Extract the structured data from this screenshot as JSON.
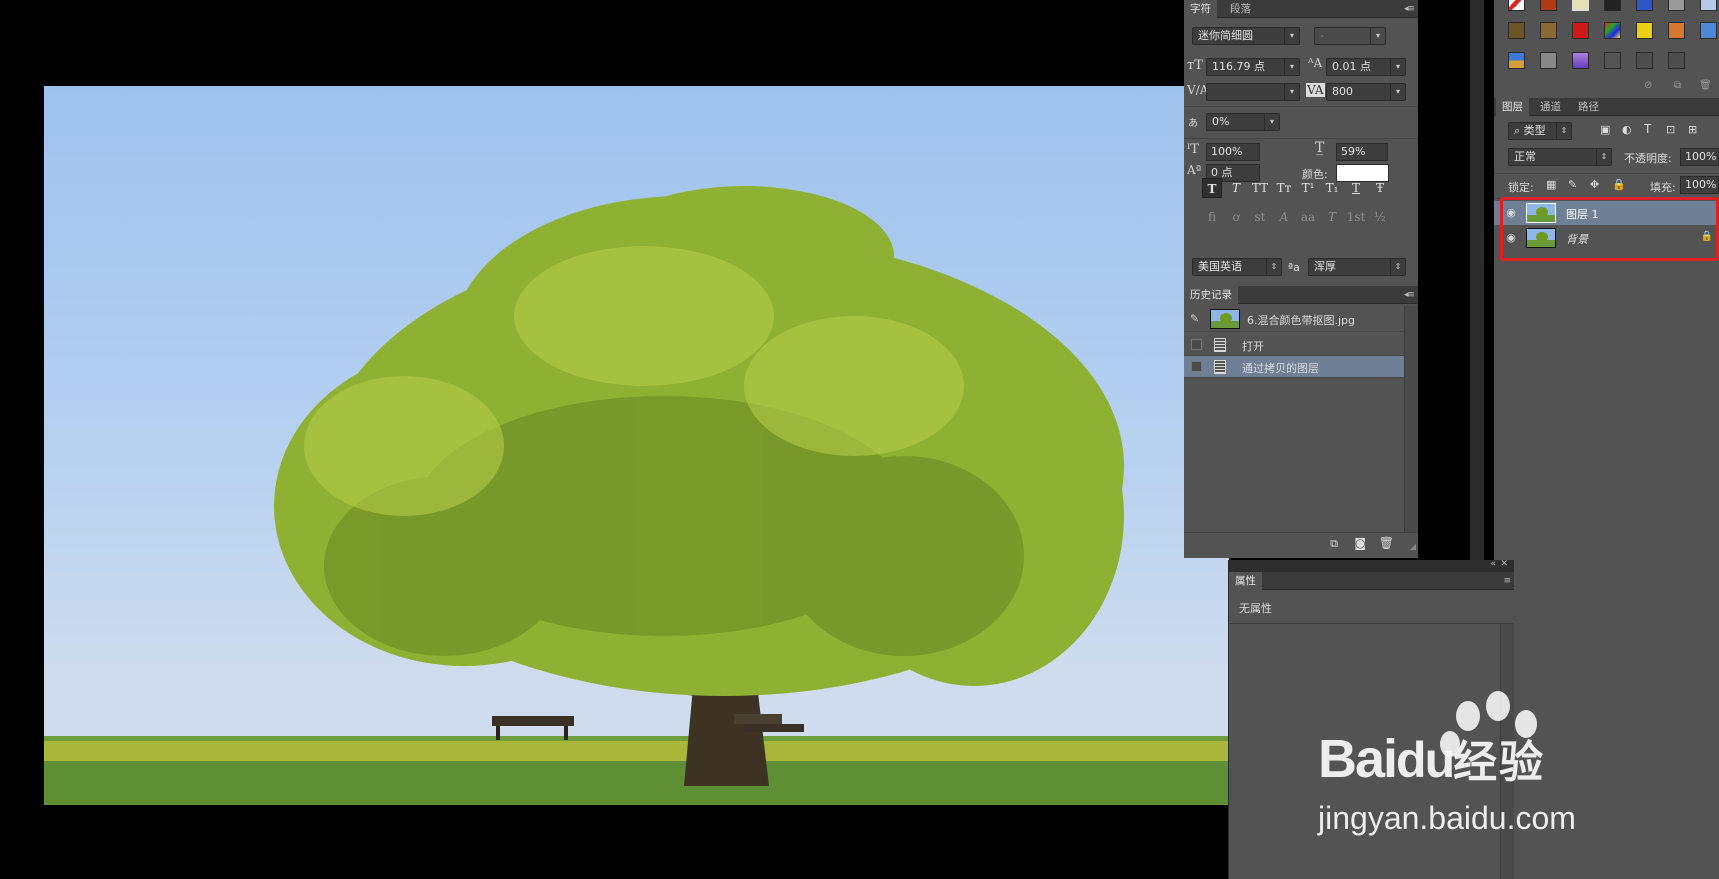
{
  "character_panel": {
    "tabs": [
      "字符",
      "段落"
    ],
    "font_family": "迷你简细圆",
    "font_style": "-",
    "font_size": "116.79 点",
    "leading": "0.01 点",
    "kerning": "",
    "tracking": "800",
    "tsume": "0%",
    "vertical_scale": "100%",
    "horizontal_scale": "59%",
    "baseline_shift": "0 点",
    "color_label": "颜色:",
    "color_value": "#ffffff",
    "style_buttons": [
      "T",
      "T",
      "TT",
      "Tт",
      "T¹",
      "T₁",
      "T",
      "Ŧ"
    ],
    "opentype_buttons": [
      "fi",
      "ơ",
      "st",
      "A",
      "aa",
      "T",
      "1st",
      "½"
    ],
    "language": "美国英语",
    "aa_label": "ªa",
    "antialias": "浑厚"
  },
  "history_panel": {
    "title": "历史记录",
    "snapshot": "6.混合颜色带抠图.jpg",
    "items": [
      "打开",
      "通过拷贝的图层"
    ],
    "selected_index": 1
  },
  "properties_panel": {
    "title": "属性",
    "content": "无属性"
  },
  "layers_panel": {
    "tabs": [
      "图层",
      "通道",
      "路径"
    ],
    "filter_kind": "类型",
    "blend_mode": "正常",
    "opacity_label": "不透明度:",
    "opacity": "100%",
    "lock_label": "锁定:",
    "fill_label": "填充:",
    "fill": "100%",
    "layers": [
      {
        "name": "图层 1",
        "selected": true
      },
      {
        "name": "背景",
        "selected": false,
        "locked": true
      }
    ]
  },
  "watermark": {
    "text": "jingyan.baidu.com",
    "logo": "Bai du 经验"
  },
  "colors": {
    "panel_bg": "#535353",
    "selection": "#6f7f95",
    "highlight_box": "#e02020"
  }
}
